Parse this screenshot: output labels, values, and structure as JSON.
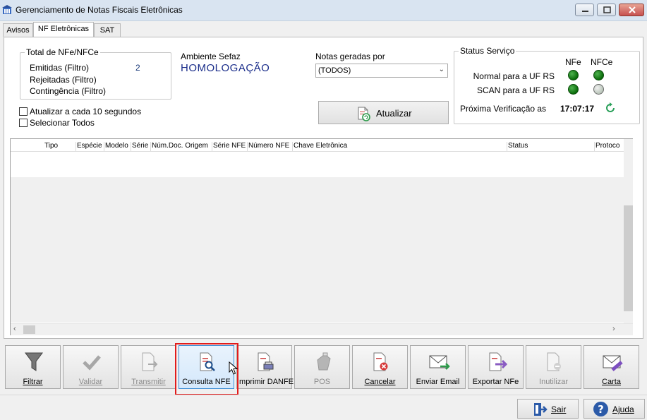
{
  "window": {
    "title": "Gerenciamento de Notas Fiscais Eletrônicas"
  },
  "tabs": [
    {
      "label": "Avisos",
      "active": false
    },
    {
      "label": "NF Eletrônicas",
      "active": true
    },
    {
      "label": "SAT",
      "active": false
    }
  ],
  "totals": {
    "group_title": "Total de NFe/NFCe",
    "emitidas_label": "Emitidas (Filtro)",
    "emitidas_value": "2",
    "rejeitadas_label": "Rejeitadas (Filtro)",
    "contingencia_label": "Contingência (Filtro)"
  },
  "ambiente": {
    "label": "Ambiente Sefaz",
    "value": "HOMOLOGAÇÃO"
  },
  "notas": {
    "label": "Notas geradas por",
    "selected": "(TODOS)"
  },
  "options": {
    "atualizar_label": "Atualizar a cada 10 segundos",
    "selecionar_label": "Selecionar Todos"
  },
  "atualizar_button": "Atualizar",
  "status": {
    "group_title": "Status Serviço",
    "col_nfe": "NFe",
    "col_nfce": "NFCe",
    "rows": [
      {
        "label": "Normal para a UF RS",
        "nfe": "online",
        "nfce": "online"
      },
      {
        "label": "SCAN para a UF RS",
        "nfe": "online",
        "nfce": "offline"
      }
    ],
    "next_label": "Próxima Verificação as",
    "next_value": "17:07:17",
    "colors": {
      "online": "#0a7a0a",
      "offline": "#c8d2c8"
    }
  },
  "grid": {
    "columns": [
      "Tipo",
      "Espécie",
      "Modelo",
      "Série",
      "Núm.Doc. Origem",
      "Série NFE",
      "Número NFE",
      "Chave Eletrônica",
      "Status",
      "Protoco"
    ]
  },
  "toolbar": {
    "filtrar": "Filtrar",
    "validar": "Validar",
    "transmitir": "Transmitir",
    "consulta": "Consulta NFE",
    "imprimir": "Imprimir DANFE",
    "pos": "POS",
    "cancelar": "Cancelar",
    "enviar_email": "Enviar Email",
    "exportar": "Exportar NFe",
    "inutilizar": "Inutilizar",
    "carta": "Carta"
  },
  "footer": {
    "sair": "Sair",
    "ajuda": "Ajuda"
  },
  "highlight_color": "#e21b1b"
}
